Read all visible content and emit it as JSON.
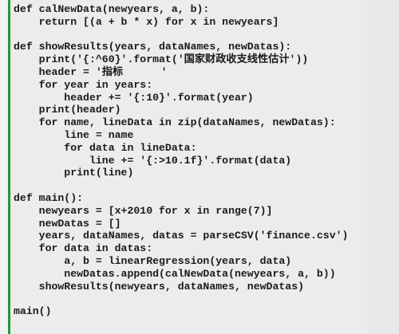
{
  "code_lines": [
    "def calNewData(newyears, a, b):",
    "    return [(a + b * x) for x in newyears]",
    "",
    "def showResults(years, dataNames, newDatas):",
    "    print('{:^60}'.format('国家财政收支线性估计'))",
    "    header = '指标      '",
    "    for year in years:",
    "        header += '{:10}'.format(year)",
    "    print(header)",
    "    for name, lineData in zip(dataNames, newDatas):",
    "        line = name",
    "        for data in lineData:",
    "            line += '{:>10.1f}'.format(data)",
    "        print(line)",
    "",
    "def main():",
    "    newyears = [x+2010 for x in range(7)]",
    "    newDatas = []",
    "    years, dataNames, datas = parseCSV('finance.csv')",
    "    for data in datas:",
    "        a, b = linearRegression(years, data)",
    "        newDatas.append(calNewData(newyears, a, b))",
    "    showResults(newyears, dataNames, newDatas)",
    "",
    "main()"
  ],
  "colors": {
    "background": "#ececec",
    "gutter_marker": "#1f9a3b",
    "text": "#1a1a1a"
  }
}
